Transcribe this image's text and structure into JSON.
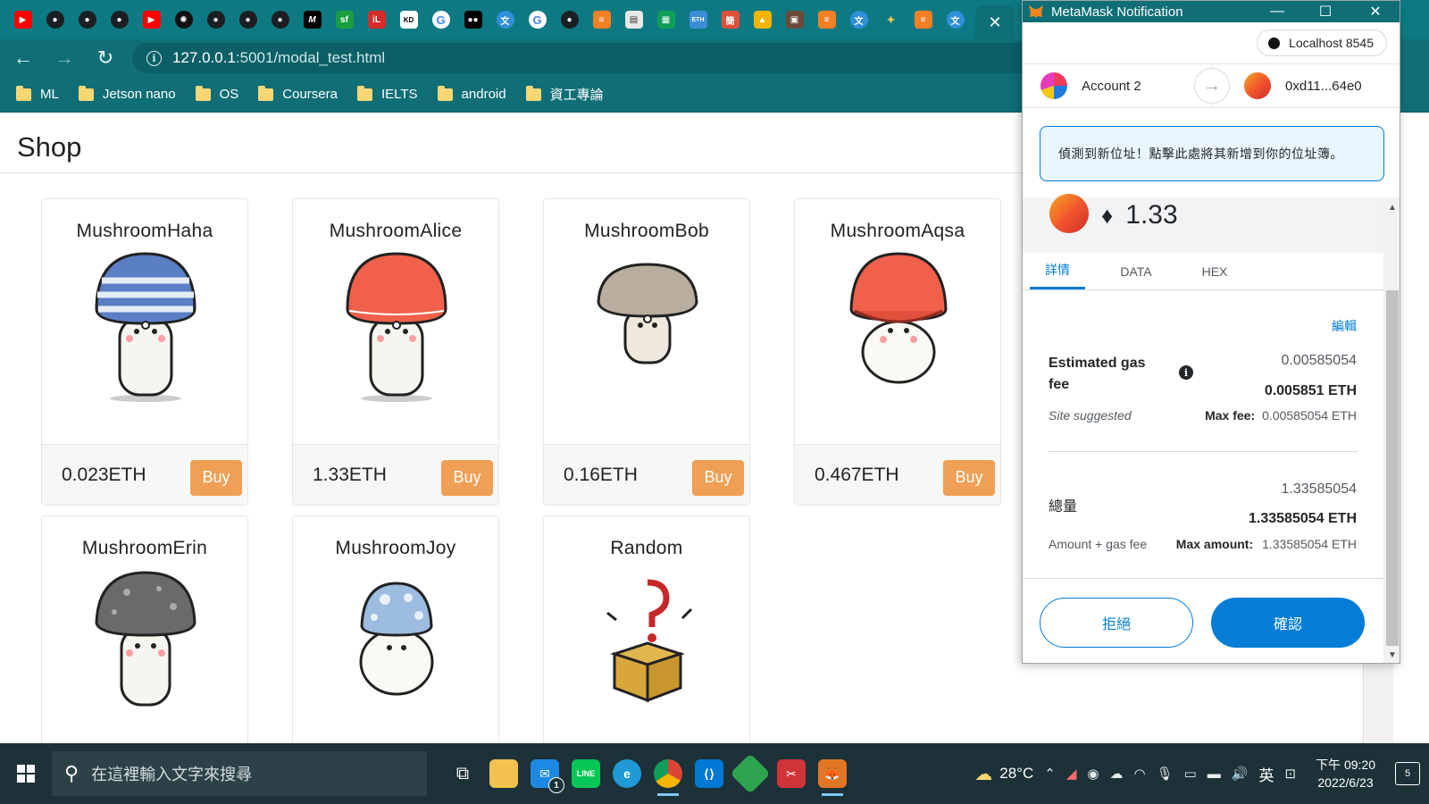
{
  "browser": {
    "tab_icons": [
      "youtube-icon",
      "github-icon",
      "github-icon",
      "github-icon",
      "youtube-icon",
      "openai-icon",
      "github-icon",
      "github-icon",
      "github-icon",
      "medium-icon",
      "sf-icon",
      "il-icon",
      "kd-icon",
      "google-icon",
      "medium-dots-icon",
      "translate-icon",
      "google-icon",
      "github-icon",
      "stackoverflow-icon",
      "reader-icon",
      "sheets-icon",
      "eth-icon",
      "chinese-icon",
      "drive-icon",
      "image-icon",
      "stackoverflow-icon",
      "translate-icon",
      "spark-icon",
      "stackoverflow-icon",
      "translate-icon"
    ],
    "tab_close": "✕",
    "url_host": "127.0.0.1",
    "url_path": ":5001/modal_test.html",
    "bookmarks": [
      "ML",
      "Jetson nano",
      "OS",
      "Coursera",
      "IELTS",
      "android",
      "資工專論"
    ]
  },
  "page": {
    "title": "Shop",
    "cards": [
      {
        "name": "MushroomHaha",
        "price": "0.023ETH",
        "buy": "Buy"
      },
      {
        "name": "MushroomAlice",
        "price": "1.33ETH",
        "buy": "Buy"
      },
      {
        "name": "MushroomBob",
        "price": "0.16ETH",
        "buy": "Buy"
      },
      {
        "name": "MushroomAqsa",
        "price": "0.467ETH",
        "buy": "Buy"
      },
      {
        "name": "MushroomErin"
      },
      {
        "name": "MushroomJoy"
      },
      {
        "name": "Random"
      }
    ]
  },
  "metamask": {
    "window_title": "MetaMask Notification",
    "network": "Localhost 8545",
    "from_account": "Account 2",
    "to_address": "0xd11...64e0",
    "alert": "偵測到新位址！點擊此處將其新增到你的位址簿。",
    "amount": "1.33",
    "tabs": [
      "詳情",
      "DATA",
      "HEX"
    ],
    "edit": "編輯",
    "gas_label_1": "Estimated gas",
    "gas_label_2": "fee",
    "gas_fiat": "0.00585054",
    "gas_eth": "0.005851 ETH",
    "site_suggested": "Site suggested",
    "max_fee_label": "Max fee:",
    "max_fee_value": "0.00585054 ETH",
    "total_label": "總量",
    "total_fiat": "1.33585054",
    "total_eth": "1.33585054 ETH",
    "amount_gas": "Amount + gas fee",
    "max_amount_label": "Max amount:",
    "max_amount_value": "1.33585054 ETH",
    "reject": "拒絕",
    "confirm": "確認",
    "colors": {
      "primary": "#037dd6",
      "alert_bg": "#eaf6ff"
    }
  },
  "taskbar": {
    "search_placeholder": "在這裡輸入文字來搜尋",
    "temperature": "28°C",
    "ime": "英",
    "time": "下午 09:20",
    "date": "2022/6/23",
    "notifications": "5",
    "mail_badge": "1"
  }
}
